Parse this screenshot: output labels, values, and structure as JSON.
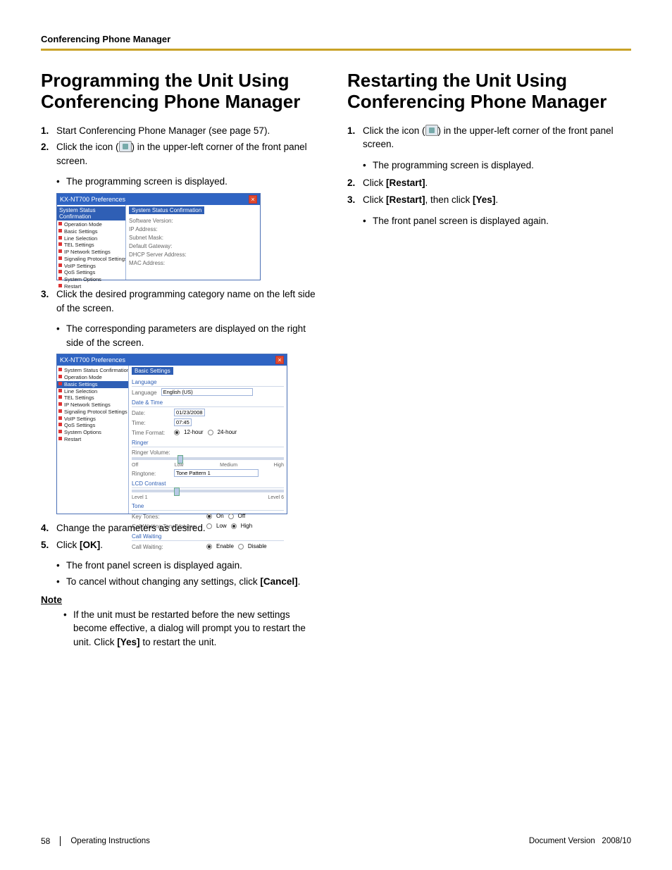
{
  "header": {
    "running": "Conferencing Phone Manager"
  },
  "left": {
    "title": "Programming the Unit Using Conferencing Phone Manager",
    "steps": {
      "s1": "Start Conferencing Phone Manager (see page 57).",
      "s2a": "Click the icon (",
      "s2b": ") in the upper-left corner of the front panel screen.",
      "s2bullet": "The programming screen is displayed.",
      "s3": "Click the desired programming category name on the left side of the screen.",
      "s3bullet": "The corresponding parameters are displayed on the right side of the screen.",
      "s4": "Change the parameters as desired.",
      "s5a": "Click ",
      "s5b": "[OK]",
      "s5c": ".",
      "s5bullet1": "The front panel screen is displayed again.",
      "s5bullet2a": "To cancel without changing any settings, click ",
      "s5bullet2b": "[Cancel]",
      "s5bullet2c": "."
    },
    "noteHeading": "Note",
    "note": {
      "a": "If the unit must be restarted before the new settings become effective, a dialog will prompt you to restart the unit. Click ",
      "b": "[Yes]",
      "c": " to restart the unit."
    },
    "shot1": {
      "title": "KX-NT700 Preferences",
      "tree_hdr": "System Status Confirmation",
      "tree": [
        "Operation Mode",
        "Basic Settings",
        "Line Selection",
        "TEL Settings",
        "IP Network Settings",
        "Signaling Protocol Settings",
        "VoIP Settings",
        "QoS Settings",
        "System Options",
        "Restart"
      ],
      "right_hdr": "System Status Confirmation",
      "labels": [
        "Software Version:",
        "IP Address:",
        "Subnet Mask:",
        "Default Gateway:",
        "DHCP Server Address:",
        "MAC Address:"
      ]
    },
    "shot2": {
      "title": "KX-NT700 Preferences",
      "tree": [
        "System Status Confirmation",
        "Operation Mode",
        "Basic Settings",
        "Line Selection",
        "TEL Settings",
        "IP Network Settings",
        "Signaling Protocol Settings",
        "VoIP Settings",
        "QoS Settings",
        "System Options",
        "Restart"
      ],
      "right_hdr": "Basic Settings",
      "lang_lbl": "Language",
      "lang_val": "English (US)",
      "dt_grp": "Date & Time",
      "date_lbl": "Date:",
      "date_val": "01/23/2008",
      "time_lbl": "Time:",
      "time_val": "07:45",
      "tf_lbl": "Time Format:",
      "tf_a": "12-hour",
      "tf_b": "24-hour",
      "ringer_grp": "Ringer",
      "rv_lbl": "Ringer Volume:",
      "rv_off": "Off",
      "rv_low": "Low",
      "rv_med": "Medium",
      "rv_high": "High",
      "rt_lbl": "Ringtone:",
      "rt_val": "Tone Pattern 1",
      "lcd_grp": "LCD Contrast",
      "lcd_l": "Level 1",
      "lcd_r": "Level 6",
      "tone_grp": "Tone",
      "kt_lbl": "Key Tones:",
      "on": "On",
      "off": "Off",
      "cwtv_lbl": "Call Waiting Tone Volume:",
      "low": "Low",
      "high": "High",
      "cw_grp": "Call Waiting",
      "cw_lbl": "Call Waiting:",
      "enable": "Enable",
      "disable": "Disable"
    }
  },
  "right": {
    "title": "Restarting the Unit Using Conferencing Phone Manager",
    "s1a": "Click the icon (",
    "s1b": ") in the upper-left corner of the front panel screen.",
    "s1bullet": "The programming screen is displayed.",
    "s2a": "Click ",
    "s2b": "[Restart]",
    "s2c": ".",
    "s3a": "Click ",
    "s3b": "[Restart]",
    "s3c": ", then click ",
    "s3d": "[Yes]",
    "s3e": ".",
    "s3bullet": "The front panel screen is displayed again."
  },
  "footer": {
    "page": "58",
    "doc": "Operating Instructions",
    "ver_lbl": "Document Version",
    "ver_val": "2008/10"
  }
}
